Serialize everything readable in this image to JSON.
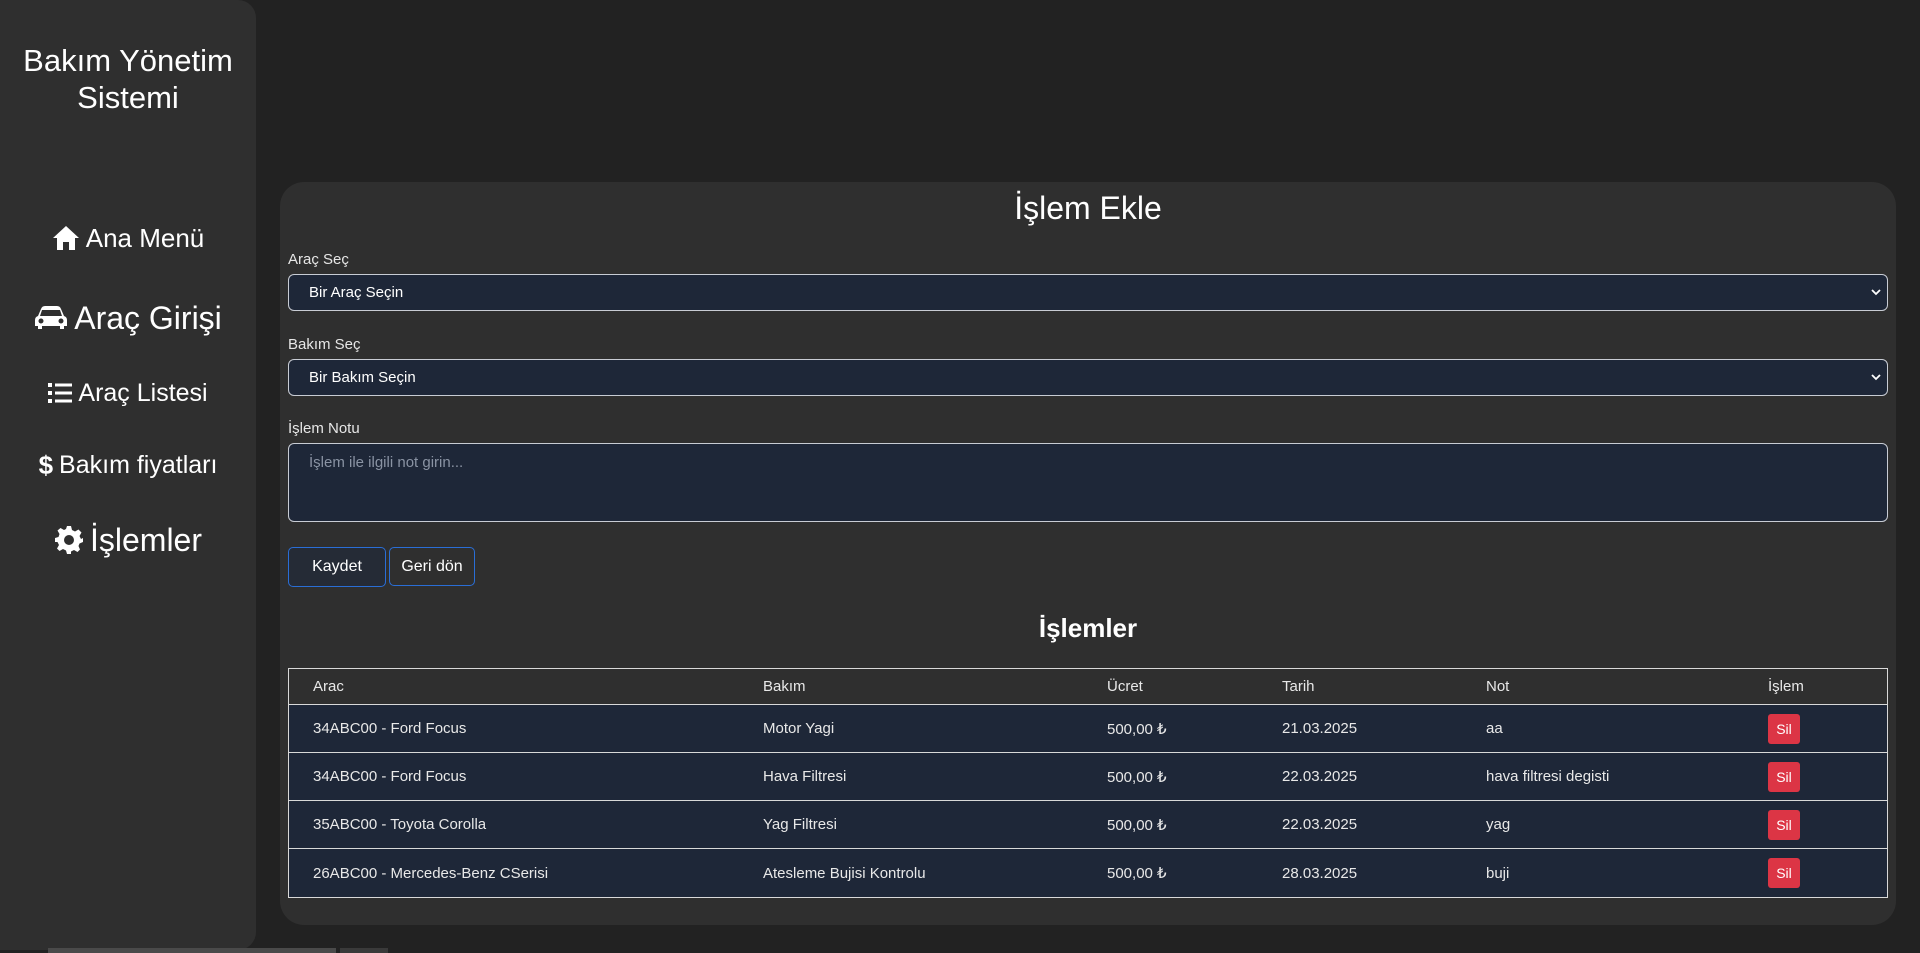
{
  "sidebar": {
    "brand_line1": "Bakım Yönetim",
    "brand_line2": "Sistemi",
    "items": [
      {
        "label": "Ana Menü",
        "icon": "home-icon"
      },
      {
        "label": "Araç Girişi",
        "icon": "car-icon"
      },
      {
        "label": "Araç Listesi",
        "icon": "list-icon"
      },
      {
        "label": "Bakım fiyatları",
        "icon": "dollar-icon"
      },
      {
        "label": "İşlemler",
        "icon": "gear-icon"
      }
    ]
  },
  "form": {
    "title": "İşlem Ekle",
    "vehicle_label": "Araç Seç",
    "vehicle_selected": "Bir Araç Seçin",
    "maintenance_label": "Bakım Seç",
    "maintenance_selected": "Bir Bakım Seçin",
    "note_label": "İşlem Notu",
    "note_placeholder": "İşlem ile ilgili not girin...",
    "save_label": "Kaydet",
    "back_label": "Geri dön"
  },
  "table": {
    "title": "İşlemler",
    "headers": [
      "Arac",
      "Bakım",
      "Ücret",
      "Tarih",
      "Not",
      "İşlem"
    ],
    "rows": [
      {
        "arac": "34ABC00 - Ford Focus",
        "bakim": "Motor Yagi",
        "ucret": "500,00 ₺",
        "tarih": "21.03.2025",
        "not": "aa",
        "action": "Sil"
      },
      {
        "arac": "34ABC00 - Ford Focus",
        "bakim": "Hava Filtresi",
        "ucret": "500,00 ₺",
        "tarih": "22.03.2025",
        "not": "hava filtresi degisti",
        "action": "Sil"
      },
      {
        "arac": "35ABC00 - Toyota Corolla",
        "bakim": "Yag Filtresi",
        "ucret": "500,00 ₺",
        "tarih": "22.03.2025",
        "not": "yag",
        "action": "Sil"
      },
      {
        "arac": "26ABC00 - Mercedes-Benz CSerisi",
        "bakim": "Atesleme Bujisi Kontrolu",
        "ucret": "500,00 ₺",
        "tarih": "28.03.2025",
        "not": "buji",
        "action": "Sil"
      }
    ]
  },
  "colors": {
    "background": "#222222",
    "panel": "#2f2f2f",
    "input": "#1e2738",
    "accent_border": "#2a6ed6",
    "danger": "#dc3545"
  }
}
